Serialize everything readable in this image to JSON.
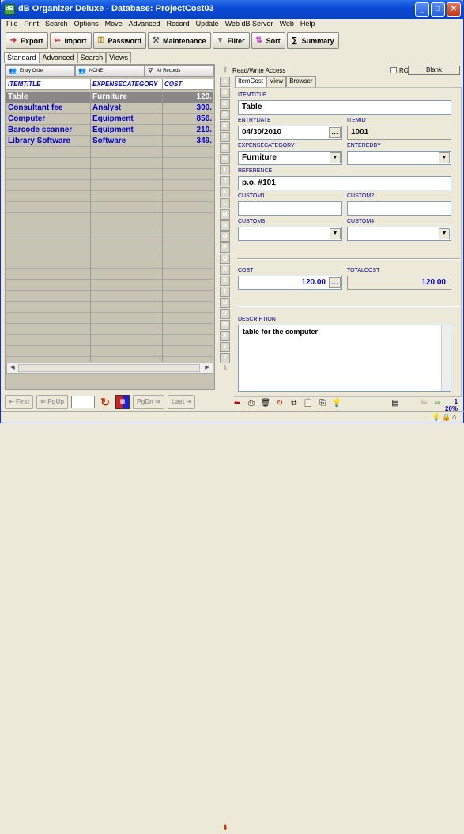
{
  "window": {
    "title": "dB Organizer Deluxe - Database: ProjectCost03",
    "icon_text": "dB"
  },
  "menu": [
    "File",
    "Print",
    "Search",
    "Options",
    "Move",
    "Advanced",
    "Record",
    "Update",
    "Web dB Server",
    "Web",
    "Help"
  ],
  "toolbar": {
    "export": "Export",
    "import": "Import",
    "password": "Password",
    "maintenance": "Maintenance",
    "filter": "Filter",
    "sort": "Sort",
    "summary": "Summary"
  },
  "left_tabs": [
    "Standard",
    "Advanced",
    "Search",
    "Views"
  ],
  "order_bar": {
    "entry_order": "Entry Order",
    "none": "NONE",
    "all_records": "All Records"
  },
  "grid": {
    "columns": [
      "ITEMTITLE",
      "EXPENSECATEGORY",
      "COST"
    ],
    "rows": [
      [
        "Table",
        "Furniture",
        "120."
      ],
      [
        "Consultant fee",
        "Analyst",
        "300."
      ],
      [
        "Computer",
        "Equipment",
        "856."
      ],
      [
        "Barcode scanner",
        "Equipment",
        "210."
      ],
      [
        "Library Software",
        "Software",
        "349."
      ]
    ],
    "selected_row": 0
  },
  "nav": {
    "first": "First",
    "pgup": "PgUp",
    "pgdn": "PgDn",
    "last": "Last"
  },
  "letters": [
    "A",
    "B",
    "C",
    "D",
    "E",
    "F",
    "G",
    "H",
    "I",
    "J",
    "K",
    "L",
    "M",
    "N",
    "O",
    "P",
    "Q",
    "R",
    "S",
    "T",
    "U",
    "V",
    "W",
    "X",
    "Y",
    "Z"
  ],
  "right_top": {
    "access": "Read/Write Access",
    "ro": "RO",
    "blank": "Blank"
  },
  "right_tabs": [
    "ItemCost",
    "View",
    "Browser"
  ],
  "form": {
    "itemtitle_label": "ITEMTITLE",
    "itemtitle": "Table",
    "entrydate_label": "ENTRYDATE",
    "entrydate": "04/30/2010",
    "itemid_label": "ITEMID",
    "itemid": "1001",
    "expensecategory_label": "EXPENSECATEGORY",
    "expensecategory": "Furniture",
    "enteredby_label": "ENTEREDBY",
    "enteredby": "",
    "reference_label": "REFERENCE",
    "reference": "p.o. #101",
    "custom1_label": "CUSTOM1",
    "custom1": "",
    "custom2_label": "CUSTOM2",
    "custom2": "",
    "custom3_label": "CUSTOM3",
    "custom3": "",
    "custom4_label": "CUSTOM4",
    "custom4": "",
    "cost_label": "COST",
    "cost": "120.00",
    "totalcost_label": "TOTALCOST",
    "totalcost": "120.00",
    "description_label": "DESCRIPTION",
    "description": "table for the computer"
  },
  "zoom": "20%",
  "zoom_value": "1",
  "colors": {
    "title_bar": "#0a4bd6",
    "grid_text": "#0000cc",
    "selected_row": "#888888",
    "label": "#000088"
  }
}
